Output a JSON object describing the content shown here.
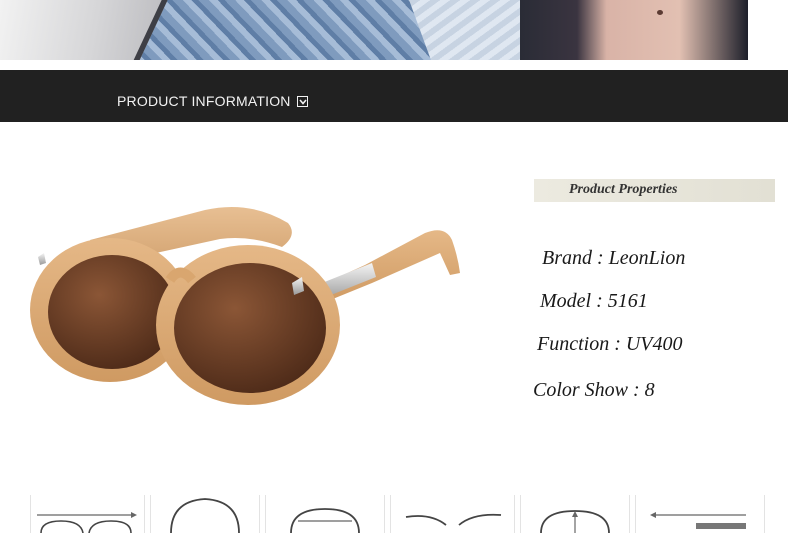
{
  "header": {
    "title": "PRODUCT INFORMATION",
    "chevron_icon": "chevron-down-box-icon"
  },
  "properties": {
    "banner_label": "Product Properties",
    "brand": "Brand : LeonLion",
    "model": "Model : 5161",
    "function": "Function : UV400",
    "color_show": "Color Show : 8"
  },
  "colors": {
    "header_bg": "#212121",
    "frame": "#d9a66f",
    "lens": "#6b3f26",
    "banner": "#e6e4d8"
  },
  "dimension_icons": [
    "lens-width-icon",
    "bridge-icon",
    "lens-height-icon",
    "nose-bridge-icon",
    "frame-height-icon",
    "temple-length-icon"
  ]
}
